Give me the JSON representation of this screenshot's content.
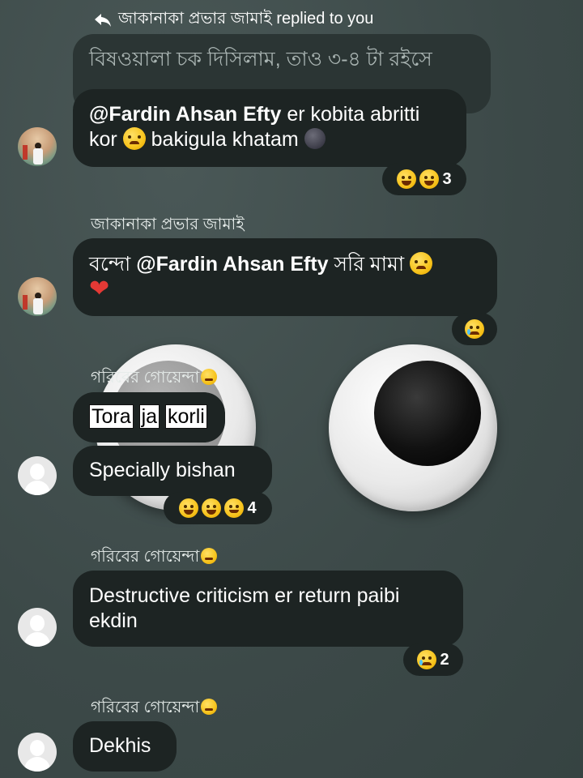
{
  "reply_header": {
    "icon": "reply-arrow-icon",
    "text": "জাকানাকা প্রভার জামাই replied to you"
  },
  "quoted_message": {
    "text": "বিষওয়ালা চক দিসিলাম, তাও ৩-৪ টা রইসে"
  },
  "messages": [
    {
      "mention": "@Fardin Ahsan Efty",
      "text_part1": " er kobita abritti kor ",
      "text_part2": " bakigula khatam ",
      "reactions": {
        "emojis": [
          "joy-emoji",
          "laughing-emoji"
        ],
        "count": "3"
      }
    },
    {
      "sender": "জাকানাকা প্রভার জামাই",
      "prefix": "বন্দো ",
      "mention": "@Fardin Ahsan Efty",
      "suffix": " সরি মামা ",
      "heart": "❤",
      "reactions": {
        "emojis": [
          "crying-emoji"
        ],
        "count": ""
      }
    },
    {
      "sender": "গরিবের গোয়েন্দা",
      "boxed_words": [
        "Tora",
        "ja",
        "korli"
      ],
      "text": ""
    },
    {
      "text": "Specially bishan",
      "reactions": {
        "emojis": [
          "laughing-emoji",
          "joy-emoji",
          "smile-emoji"
        ],
        "count": "4"
      }
    },
    {
      "sender": "গরিবের গোয়েন্দা",
      "text": "Destructive criticism er return paibi ekdin",
      "reactions": {
        "emojis": [
          "crying-emoji"
        ],
        "count": "2"
      }
    },
    {
      "sender": "গরিবের গোয়েন্দা",
      "text": "Dekhis"
    }
  ],
  "colors": {
    "background": "#3f4d4c",
    "bubble": "#1d2423",
    "quoted_bubble": "#2b3534",
    "heart": "#e53935"
  }
}
